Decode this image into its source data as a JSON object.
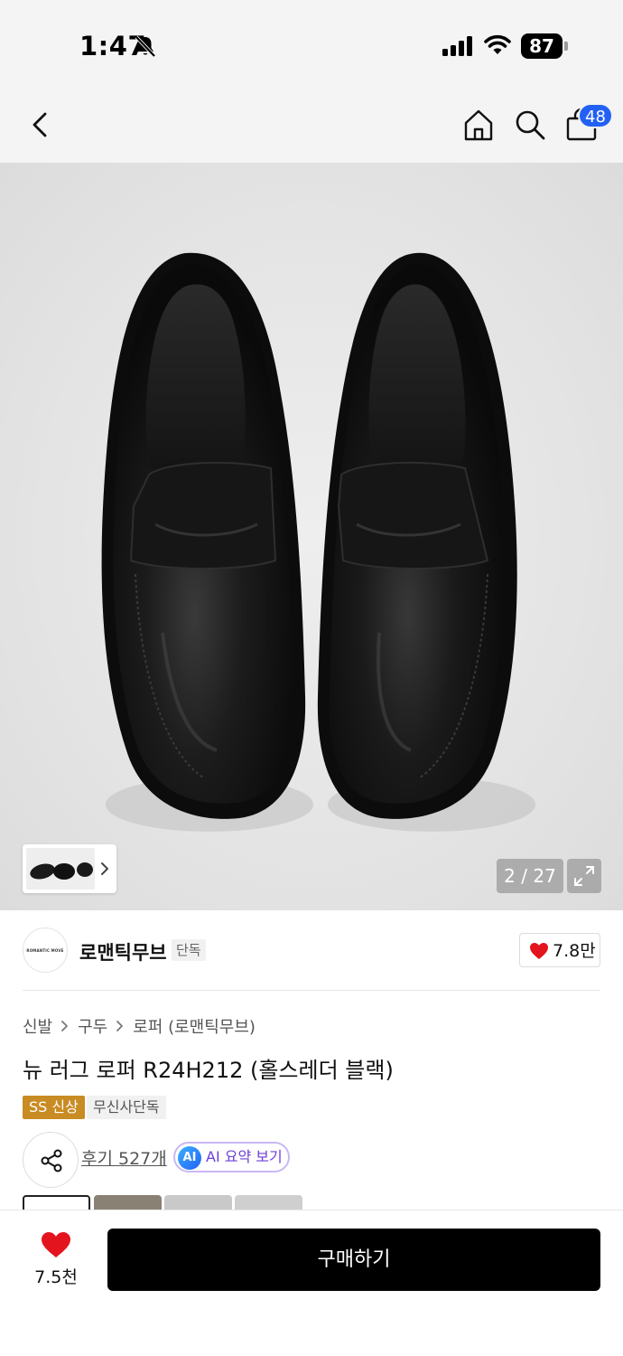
{
  "status_bar": {
    "time": "1:47",
    "battery": "87",
    "icons": [
      "bell-off-icon",
      "signal-icon",
      "wifi-icon",
      "battery-icon"
    ]
  },
  "nav": {
    "cart_count": "48",
    "icons": [
      "back-chevron-icon",
      "home-icon",
      "search-icon",
      "shopping-bag-icon"
    ]
  },
  "gallery": {
    "counter": "2 / 27",
    "icons": [
      "expand-icon",
      "chevron-right-icon"
    ]
  },
  "brand": {
    "logo_text": "ROMANTIC MOVE",
    "name": "로맨틱무브",
    "tag": "단독",
    "like_count": "7.8만"
  },
  "breadcrumb": [
    "신발",
    "구두",
    "로퍼 (로맨틱무브)"
  ],
  "product": {
    "title": "뉴 러그 로퍼 R24H212 (홀스레더 블랙)",
    "tags": [
      "SS 신상",
      "무신사단독"
    ]
  },
  "reviews": {
    "label": "후기 527개",
    "ai_badge": "AI",
    "ai_label": "AI 요약 보기"
  },
  "bottom": {
    "like_count": "7.5천",
    "buy_label": "구매하기"
  },
  "colors": {
    "like_red": "#e3141e",
    "badge_blue": "#2361f5",
    "tag_gold": "#c98b23",
    "ai_purple": "#6b3fd6"
  }
}
